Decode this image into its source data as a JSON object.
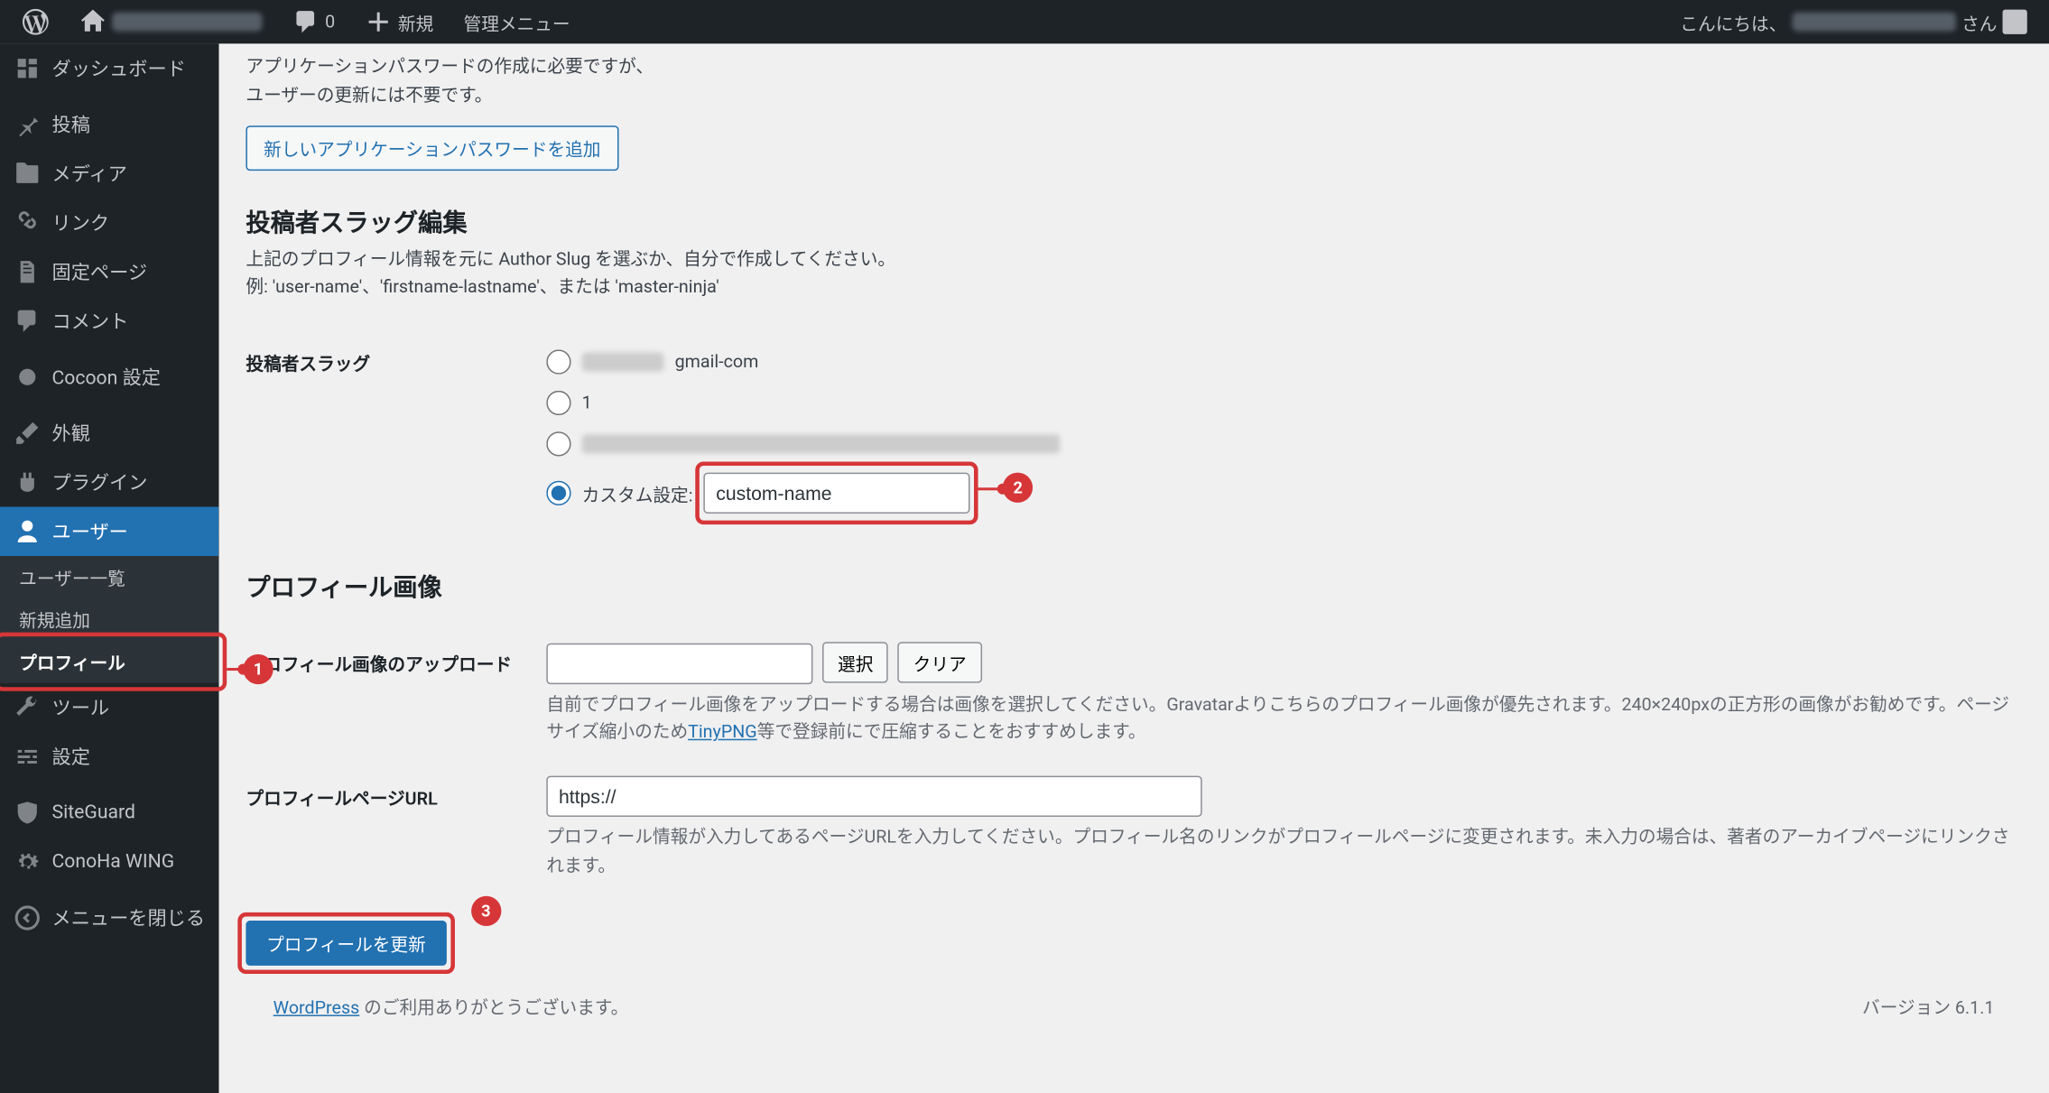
{
  "adminbar": {
    "comments_count": "0",
    "new_label": "新規",
    "admin_menu_label": "管理メニュー",
    "greeting_prefix": "こんにちは、",
    "greeting_suffix": "さん"
  },
  "sidebar": {
    "items": [
      {
        "label": "ダッシュボード",
        "icon": "dashboard-icon"
      },
      {
        "label": "投稿",
        "icon": "pin-icon"
      },
      {
        "label": "メディア",
        "icon": "media-icon"
      },
      {
        "label": "リンク",
        "icon": "link-icon"
      },
      {
        "label": "固定ページ",
        "icon": "page-icon"
      },
      {
        "label": "コメント",
        "icon": "comment-icon"
      },
      {
        "label": "Cocoon 設定",
        "icon": "circle-icon"
      },
      {
        "label": "外観",
        "icon": "brush-icon"
      },
      {
        "label": "プラグイン",
        "icon": "plug-icon"
      },
      {
        "label": "ユーザー",
        "icon": "user-icon"
      },
      {
        "label": "ツール",
        "icon": "wrench-icon"
      },
      {
        "label": "設定",
        "icon": "sliders-icon"
      },
      {
        "label": "SiteGuard",
        "icon": "shield-icon"
      },
      {
        "label": "ConoHa WING",
        "icon": "gear-icon"
      },
      {
        "label": "メニューを閉じる",
        "icon": "collapse-icon"
      }
    ],
    "submenu_users": {
      "list": "ユーザー一覧",
      "new": "新規追加",
      "profile": "プロフィール"
    }
  },
  "content": {
    "app_pw_text_1": "アプリケーションパスワードの作成に必要ですが、",
    "app_pw_text_2": "ユーザーの更新には不要です。",
    "app_pw_btn": "新しいアプリケーションパスワードを追加",
    "slug_section_title": "投稿者スラッグ編集",
    "slug_desc_1": "上記のプロフィール情報を元に Author Slug を選ぶか、自分で作成してください。",
    "slug_desc_2": "例: 'user-name'、'firstname-lastname'、または 'master-ninja'",
    "slug_label": "投稿者スラッグ",
    "slug_opt1_suffix": "gmail-com",
    "slug_opt2": "1",
    "slug_opt_custom": "カスタム設定:",
    "custom_value": "custom-name",
    "profile_img_title": "プロフィール画像",
    "upload_label": "プロフィール画像のアップロード",
    "select_btn": "選択",
    "clear_btn": "クリア",
    "upload_desc_1": "自前でプロフィール画像をアップロードする場合は画像を選択してください。Gravatarよりこちらのプロフィール画像が優先されます。240×240pxの正方形の画像がお勧めです。ページサイズ縮小のため",
    "upload_desc_link": "TinyPNG",
    "upload_desc_2": "等で登録前にで圧縮することをおすすめします。",
    "url_label": "プロフィールページURL",
    "url_value": "https://",
    "url_desc": "プロフィール情報が入力してあるページURLを入力してください。プロフィール名のリンクがプロフィールページに変更されます。未入力の場合は、著者のアーカイブページにリンクされます。",
    "update_btn": "プロフィールを更新"
  },
  "footer": {
    "wp_link": "WordPress",
    "thanks": " のご利用ありがとうございます。",
    "version": "バージョン 6.1.1"
  },
  "annotations": {
    "b1": "1",
    "b2": "2",
    "b3": "3"
  }
}
